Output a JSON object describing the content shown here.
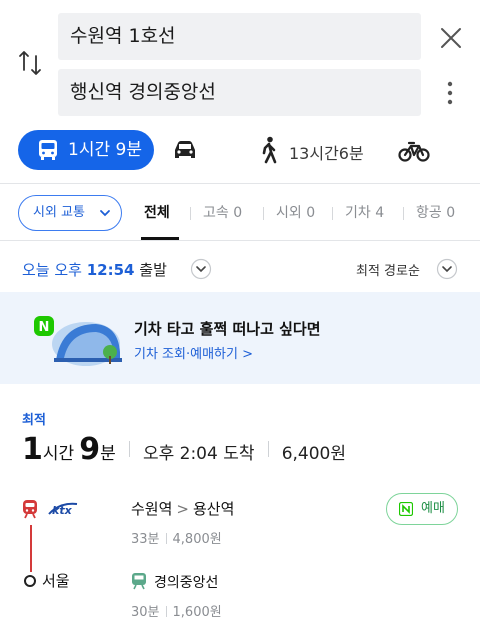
{
  "search": {
    "origin": "수원역 1호선",
    "destination": "행신역 경의중앙선"
  },
  "modes": {
    "transit_time": "1시간 9분",
    "walk_time": "13시간6분"
  },
  "filter": {
    "category_label": "시외 교통",
    "tabs": [
      {
        "label": "전체"
      },
      {
        "label": "고속",
        "count": "0"
      },
      {
        "label": "시외",
        "count": "0"
      },
      {
        "label": "기차",
        "count": "4"
      },
      {
        "label": "항공",
        "count": "0"
      }
    ]
  },
  "departure": {
    "prefix": "오늘 오후",
    "time": "12:54",
    "suffix": "출발",
    "sort_label": "최적 경로순"
  },
  "banner": {
    "title": "기차 타고 훌쩍 떠나고 싶다면",
    "link": "기차 조회·예매하기 >"
  },
  "result": {
    "badge": "최적",
    "hours": "1",
    "hours_unit": "시간",
    "minutes": "9",
    "minutes_unit": "분",
    "arrival": "오후 2:04 도착",
    "fare": "6,400원",
    "legs": [
      {
        "brand": "KTX",
        "from": "수원역",
        "to": "용산역",
        "duration": "33분",
        "fare": "4,800원",
        "book_label": "예매"
      },
      {
        "stop": "서울",
        "line": "경의중앙선",
        "duration": "30분",
        "fare": "1,600원"
      }
    ]
  },
  "colors": {
    "accent": "#1565e8",
    "ktx_red": "#d43a3a",
    "naver_green": "#1ec800"
  }
}
